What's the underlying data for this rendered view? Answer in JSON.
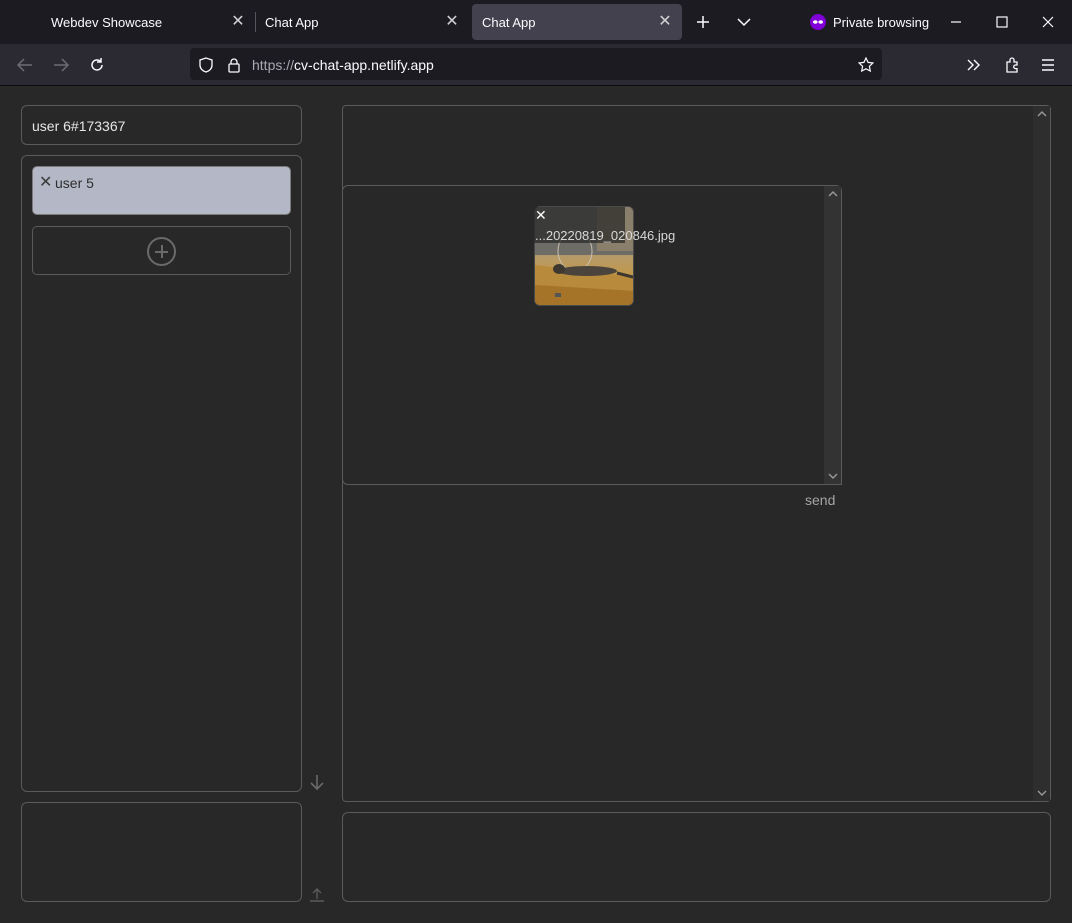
{
  "browser": {
    "tabs": [
      {
        "label": "Webdev Showcase",
        "active": false
      },
      {
        "label": "Chat App",
        "active": false
      },
      {
        "label": "Chat App",
        "active": true
      }
    ],
    "private_label": "Private browsing",
    "url_scheme": "https://",
    "url_host": "cv-chat-app.netlify.app"
  },
  "app": {
    "current_user": "user 6#173367",
    "contacts": [
      {
        "name": "user 5",
        "remove_icon": "close-icon"
      }
    ],
    "add_contact_icon": "plus-circle-icon",
    "attachment": {
      "filename": "...20220819_020846.jpg",
      "remove_icon": "close-icon"
    },
    "send_label": "send"
  },
  "colors": {
    "chrome_dark": "#1c1b22",
    "chrome_bar": "#2b2a33",
    "active_tab": "#42414d",
    "app_background": "#282828",
    "contact_card": "#b4b8c6",
    "private_accent": "#8000d7"
  }
}
